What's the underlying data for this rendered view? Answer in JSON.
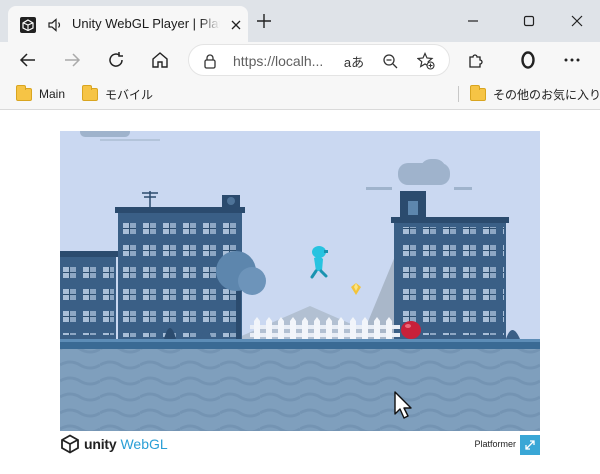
{
  "browser": {
    "tab": {
      "title": "Unity WebGL Player | Platformer"
    },
    "address_bar": {
      "url": "https://localh..."
    },
    "bookmarks": [
      {
        "label": "Main"
      },
      {
        "label": "モバイル"
      }
    ],
    "other_bookmarks_label": "その他のお気に入り"
  },
  "icons": {
    "unity_tab_icon": "unity-logo-icon",
    "audio": "speaker-icon",
    "close": "close-icon",
    "new_tab": "plus-icon",
    "minimize": "minimize-icon",
    "maximize": "maximize-icon",
    "window_close": "close-icon",
    "back": "back-arrow-icon",
    "forward": "forward-arrow-icon",
    "refresh": "refresh-icon",
    "home": "home-icon",
    "lock": "lock-icon",
    "read_aloud": "read-aloud-icon",
    "zoom": "zoom-out-icon",
    "favorite": "star-add-icon",
    "extensions": "puzzle-icon",
    "profile": "profile-ring-icon",
    "menu": "more-icon"
  },
  "read_aloud_glyph": "aあ",
  "footer": {
    "unity_word": "unity",
    "webgl_word": "WebGL",
    "product_name": "Platformer"
  },
  "colors": {
    "chrome_bg": "#f7f7f7",
    "titlebar_bg": "#dfe3e8",
    "game_sky": "#cad8f1",
    "webgl_accent": "#2a9fd6",
    "fullscreen_button": "#3aa7d6",
    "player": "#27c3e0",
    "enemy": "#c8203a"
  }
}
